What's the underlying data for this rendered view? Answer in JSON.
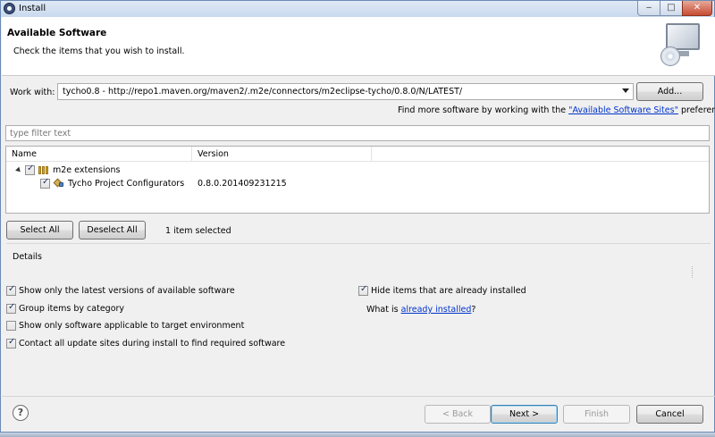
{
  "window": {
    "title": "Install",
    "minimize_symbol": "‒",
    "maximize_symbol": "□",
    "close_symbol": "✕"
  },
  "header": {
    "title": "Available Software",
    "subtitle": "Check the items that you wish to install.",
    "icon": "monitor-with-disc-icon"
  },
  "work_with": {
    "label": "Work with:",
    "value": "tycho0.8 - http://repo1.maven.org/maven2/.m2e/connectors/m2eclipse-tycho/0.8.0/N/LATEST/",
    "add_label": "Add..."
  },
  "find_more": {
    "prefix": "Find more software by working with the ",
    "link": "\"Available Software Sites\"",
    "suffix": " preferences."
  },
  "filter": {
    "placeholder": "type filter text"
  },
  "tree": {
    "columns": [
      "Name",
      "Version"
    ],
    "rows": [
      {
        "name": "m2e extensions",
        "version": "",
        "checked": true,
        "icon": "folder-category-icon"
      },
      {
        "name": "Tycho Project Configurators",
        "version": "0.8.0.201409231215",
        "checked": true,
        "icon": "plugin-feature-icon"
      }
    ]
  },
  "selection": {
    "select_all": "Select All",
    "deselect_all": "Deselect All",
    "status": "1 item selected"
  },
  "details": {
    "label": "Details"
  },
  "options": {
    "latest_versions": {
      "label": "Show only the latest versions of available software",
      "checked": true
    },
    "group_by_category": {
      "label": "Group items by category",
      "checked": true
    },
    "target_env": {
      "label": "Show only software applicable to target environment",
      "checked": false
    },
    "contact_sites": {
      "label": "Contact all update sites during install to find required software",
      "checked": true
    },
    "hide_installed": {
      "label": "Hide items that are already installed",
      "checked": true
    },
    "what_is_prefix": "What is ",
    "what_is_link": "already installed",
    "what_is_suffix": "?"
  },
  "footer": {
    "help_symbol": "?",
    "back_label": "< Back",
    "next_label": "Next >",
    "finish_label": "Finish",
    "cancel_label": "Cancel"
  }
}
